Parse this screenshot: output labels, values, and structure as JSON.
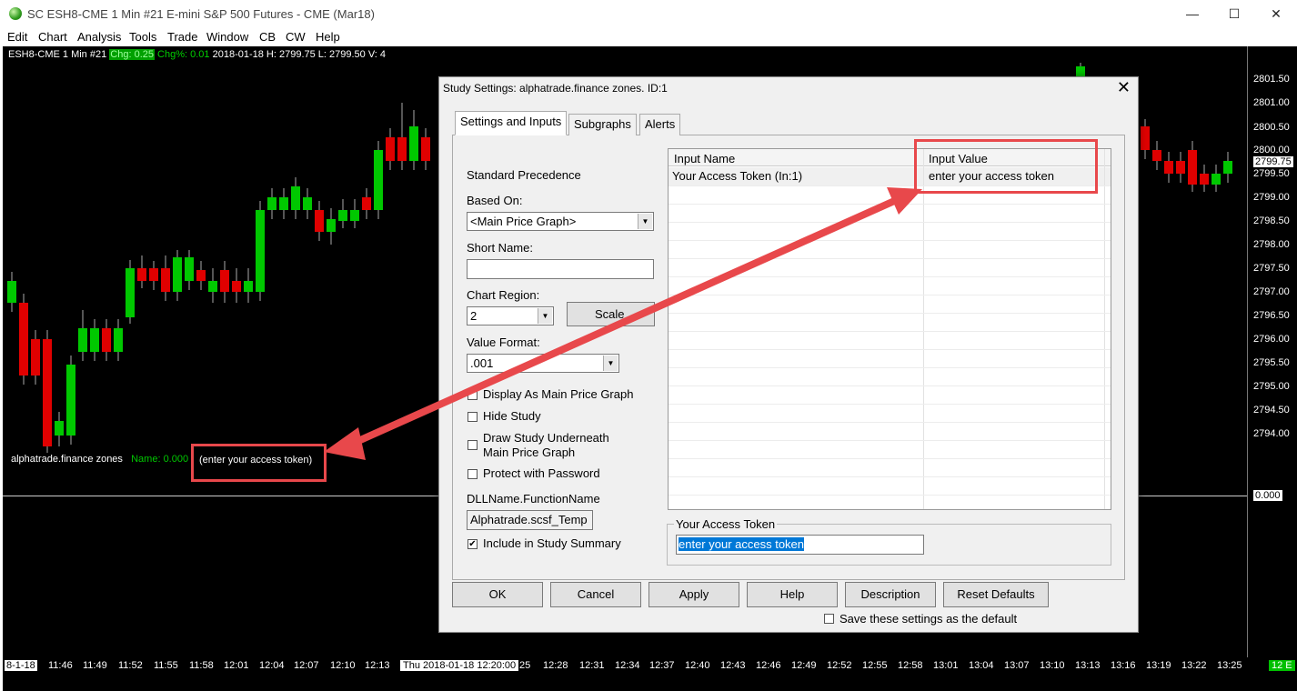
{
  "window": {
    "title": "SC ESH8-CME  1 Min   #21  E-mini S&P 500 Futures - CME (Mar18)",
    "minimize": "—",
    "maximize": "☐",
    "close": "✕"
  },
  "menu": [
    "Edit",
    "Chart",
    "Analysis",
    "Tools",
    "Trade",
    "Window",
    "CB",
    "CW",
    "Help"
  ],
  "chart": {
    "header_symbol": "ESH8-CME  1 Min   #21",
    "header_chg": "Chg: 0.25",
    "header_chgpct": "Chg%: 0.01",
    "header_rest": "2018-01-18 H: 2799.75  L: 2799.50  V: 4",
    "study_name": "alphatrade.finance zones",
    "study_name_value": "Name: 0.000",
    "study_token_text": "(enter your access token)",
    "colors": {
      "up": "#00c800",
      "down": "#e00000",
      "background": "#000000"
    },
    "price_ticks": [
      "2801.50",
      "2801.00",
      "2800.50",
      "2800.00",
      "2799.75",
      "2799.50",
      "2799.00",
      "2798.50",
      "2798.00",
      "2797.50",
      "2797.00",
      "2796.50",
      "2796.00",
      "2795.50",
      "2795.00",
      "2794.50",
      "2794.00",
      "0.000"
    ],
    "time_ticks": [
      "8-1-18",
      "11:46",
      "11:49",
      "11:52",
      "11:55",
      "11:58",
      "12:01",
      "12:04",
      "12:07",
      "12:10",
      "12:13",
      "Thu 2018-01-18  12:20:00",
      "25",
      "12:28",
      "12:31",
      "12:34",
      "12:37",
      "12:40",
      "12:43",
      "12:46",
      "12:49",
      "12:52",
      "12:55",
      "12:58",
      "13:01",
      "13:04",
      "13:07",
      "13:10",
      "13:13",
      "13:16",
      "13:19",
      "13:22",
      "13:25",
      "12 E"
    ]
  },
  "dialog": {
    "title": "Study Settings: alphatrade.finance zones. ID:1",
    "close": "✕",
    "tabs": [
      "Settings and Inputs",
      "Subgraphs",
      "Alerts"
    ],
    "standard_precedence": "Standard Precedence",
    "based_on_label": "Based On:",
    "based_on_value": "<Main Price Graph>",
    "short_name_label": "Short Name:",
    "short_name_value": "",
    "chart_region_label": "Chart Region:",
    "chart_region_value": "2",
    "scale_button": "Scale",
    "value_format_label": "Value Format:",
    "value_format_value": ".001",
    "display_main": "Display As Main Price Graph",
    "hide_study": "Hide Study",
    "draw_underneath_1": "Draw Study Underneath",
    "draw_underneath_2": "Main Price Graph",
    "protect_password": "Protect with Password",
    "dll_label": "DLLName.FunctionName",
    "dll_value": "Alphatrade.scsf_Temp",
    "include_summary": "Include in Study Summary",
    "include_summary_checked": "✔",
    "grid_col_name": "Input Name",
    "grid_col_value": "Input Value",
    "grid_row_name": "Your Access Token  (In:1)",
    "grid_row_value": "enter your access token",
    "group_label": "Your Access Token",
    "token_value": "enter your access token",
    "buttons": [
      "OK",
      "Cancel",
      "Apply",
      "Help",
      "Description",
      "Reset Defaults"
    ],
    "save_default": "Save these settings as the default"
  }
}
